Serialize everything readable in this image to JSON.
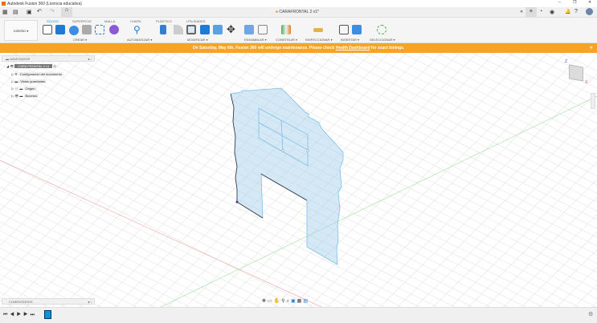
{
  "window": {
    "title": "Autodesk Fusion 360 (Licencia educativa)",
    "doc_tab": "CARAFRONTAL 2 v1*"
  },
  "toolbar": {
    "workspace": "DISEÑO",
    "tabs": [
      "SÓLIDO",
      "SUPERFICIE",
      "MALLA",
      "CHAPA",
      "PLÁSTICO",
      "UTILIDADES"
    ],
    "active_tab": "SÓLIDO",
    "groups": [
      "CREAR",
      "AUTOMATIZAR",
      "MODIFICAR",
      "ENSAMBLAR",
      "CONSTRUIR",
      "INSPECCIONAR",
      "INSERTAR",
      "SELECCIONAR"
    ]
  },
  "banner": {
    "text_before": "On Saturday, May 6th, Fusion 360 will undergo maintenance. Please check ",
    "link": "Health Dashboard",
    "text_after": " for exact timings."
  },
  "navigator": {
    "title": "NAVEGADOR",
    "root": "CARA FRONTAL 2 v1",
    "items": [
      "Configuración del documento",
      "Vistas guardadas",
      "Origen",
      "Bocetos"
    ]
  },
  "comments": {
    "title": "COMENTARIOS"
  },
  "viewcube": {
    "axes": [
      "Z",
      "X"
    ]
  },
  "accent": "#0696d7"
}
